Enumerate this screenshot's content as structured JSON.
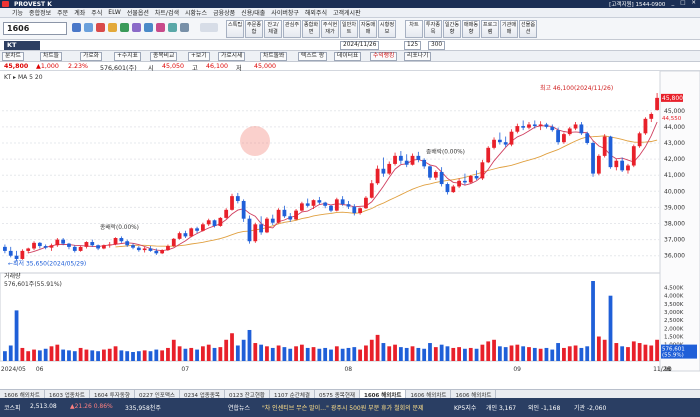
{
  "titlebar": {
    "brand": "PROVEST K",
    "phone": "[고객지원] 1544-0900",
    "controls": [
      "_",
      "□",
      "✕"
    ]
  },
  "menu": [
    "기능",
    "종합정보",
    "주문",
    "계좌",
    "주식",
    "ELW",
    "선물옵션",
    "차트/검색",
    "시황뉴스",
    "금융상품",
    "신용/대출",
    "사이버창구",
    "해외주식",
    "고객게시판"
  ],
  "toolbar": {
    "code": "1606",
    "buttons": [
      "스톡팁",
      "주문종합",
      "잔고/체결",
      "관심주",
      "종합화면",
      "주식현재가",
      "일반차트",
      "자동매매",
      "시황정보",
      "차트",
      "투자종목",
      "일간동향",
      "매매동향",
      "프로그램",
      "기관매매",
      "선물옵션"
    ]
  },
  "stock": {
    "symbol": "KT",
    "period": "일",
    "interval": "1",
    "date": "2024/11/26",
    "count": "125",
    "count2": "300"
  },
  "chart_toolbar": [
    "분차트",
    "차트들",
    "가로화",
    "+수지표",
    "종목비교",
    "+보기",
    "가로시세",
    "차트돌봐",
    "텍스트 랑",
    "데이터표",
    "수익랭킹",
    "리포나기"
  ],
  "quote": {
    "price": "45,800",
    "change": "▲1,000",
    "pct": "2.23%",
    "volume": "576,601(주)",
    "open_lbl": "시",
    "open": "45,050",
    "high_lbl": "고",
    "high": "46,100",
    "low_lbl": "저",
    "low": "45,000"
  },
  "chart_labels": {
    "legend": "KT ▸ MA 5 20",
    "annot_high": "최고 46,100(2024/11/26)",
    "annot_low": "←최저 35,650(2024/05/29)",
    "annot_div1": "종배락(0.00%)",
    "annot_div2": "종배락(0.00%)",
    "volume_title": "거래량",
    "volume_value": "576,601주(55.91%)",
    "right_buttons": [
      "일",
      "매수",
      "매도"
    ],
    "pin": "45,800",
    "sub_pin": "44,550",
    "last_vol": "576,601",
    "last_vol_pct": "(55.9%)"
  },
  "chart_data": {
    "type": "candlestick",
    "y_ticks": [
      36000,
      37000,
      38000,
      39000,
      40000,
      41000,
      42000,
      43000,
      44000,
      45000
    ],
    "y_range": [
      35300,
      46600
    ],
    "x_ticks": [
      "2024/05",
      "06",
      "07",
      "08",
      "09",
      "10",
      "11",
      "11/26"
    ],
    "volume_ticks": [
      "4,500K",
      "4,000K",
      "3,500K",
      "3,000K",
      "2,500K",
      "2,000K",
      "1,500K",
      "1,000K",
      "500K"
    ],
    "volume_max": 4900000,
    "candles": [
      [
        36550,
        36700,
        36150,
        36300
      ],
      [
        36300,
        36550,
        35900,
        36000
      ],
      [
        36000,
        36300,
        35650,
        35800
      ],
      [
        35800,
        36400,
        35750,
        36300
      ],
      [
        36300,
        36500,
        36150,
        36450
      ],
      [
        36450,
        36900,
        36350,
        36800
      ],
      [
        36800,
        36850,
        36450,
        36600
      ],
      [
        36600,
        36700,
        36400,
        36500
      ],
      [
        36500,
        36750,
        36300,
        36650
      ],
      [
        36650,
        37100,
        36550,
        37000
      ],
      [
        37000,
        37100,
        36650,
        36750
      ],
      [
        36750,
        36800,
        36400,
        36550
      ],
      [
        36550,
        36650,
        36200,
        36300
      ],
      [
        36300,
        36600,
        36250,
        36550
      ],
      [
        36550,
        36900,
        36450,
        36850
      ],
      [
        36850,
        37000,
        36550,
        36650
      ],
      [
        36650,
        36700,
        36350,
        36450
      ],
      [
        36450,
        36700,
        36400,
        36650
      ],
      [
        36650,
        36850,
        36500,
        36700
      ],
      [
        36700,
        37150,
        36650,
        37100
      ],
      [
        37100,
        37200,
        36800,
        36900
      ],
      [
        36900,
        37000,
        36550,
        36650
      ],
      [
        36650,
        36750,
        36400,
        36500
      ],
      [
        36500,
        36600,
        36250,
        36350
      ],
      [
        36350,
        36550,
        36200,
        36450
      ],
      [
        36450,
        36600,
        36250,
        36300
      ],
      [
        36300,
        36450,
        36050,
        36150
      ],
      [
        36150,
        36400,
        36100,
        36350
      ],
      [
        36350,
        36700,
        36300,
        36600
      ],
      [
        36600,
        37100,
        36550,
        37050
      ],
      [
        37050,
        37500,
        37000,
        37400
      ],
      [
        37400,
        37550,
        37100,
        37200
      ],
      [
        37200,
        37750,
        37150,
        37700
      ],
      [
        37700,
        37800,
        37400,
        37550
      ],
      [
        37550,
        38050,
        37500,
        37950
      ],
      [
        37950,
        38300,
        37850,
        38200
      ],
      [
        38200,
        38250,
        37750,
        37850
      ],
      [
        37850,
        38400,
        37800,
        38350
      ],
      [
        38350,
        38950,
        38300,
        38850
      ],
      [
        38850,
        39850,
        38800,
        39700
      ],
      [
        39700,
        39900,
        39250,
        39400
      ],
      [
        39400,
        39500,
        38100,
        38300
      ],
      [
        38300,
        38500,
        36750,
        36900
      ],
      [
        36900,
        38050,
        36800,
        37950
      ],
      [
        37950,
        38450,
        37300,
        37450
      ],
      [
        37450,
        38400,
        37400,
        38300
      ],
      [
        38300,
        38550,
        37900,
        38050
      ],
      [
        38050,
        38950,
        38000,
        38850
      ],
      [
        38850,
        39100,
        38350,
        38450
      ],
      [
        38450,
        38650,
        38100,
        38250
      ],
      [
        38250,
        38900,
        38200,
        38800
      ],
      [
        38800,
        39350,
        38750,
        39250
      ],
      [
        39250,
        39550,
        39000,
        39100
      ],
      [
        39100,
        39500,
        38900,
        39450
      ],
      [
        39450,
        39650,
        39200,
        39300
      ],
      [
        39300,
        39350,
        38950,
        39100
      ],
      [
        39100,
        39150,
        38700,
        38800
      ],
      [
        38800,
        39600,
        38750,
        39500
      ],
      [
        39500,
        39700,
        39100,
        39200
      ],
      [
        39200,
        39400,
        38900,
        39050
      ],
      [
        39050,
        39200,
        38500,
        38650
      ],
      [
        38650,
        39000,
        38550,
        38950
      ],
      [
        38950,
        39700,
        38900,
        39600
      ],
      [
        39600,
        40700,
        39550,
        40500
      ],
      [
        40500,
        41600,
        40400,
        41400
      ],
      [
        41400,
        42100,
        40900,
        41100
      ],
      [
        41100,
        41850,
        41000,
        41700
      ],
      [
        41700,
        42400,
        41600,
        42200
      ],
      [
        42200,
        42500,
        41700,
        41900
      ],
      [
        41900,
        42300,
        41500,
        41650
      ],
      [
        41650,
        42350,
        41600,
        42200
      ],
      [
        42200,
        42450,
        41800,
        41950
      ],
      [
        41950,
        42050,
        41400,
        41550
      ],
      [
        41550,
        41600,
        40700,
        40850
      ],
      [
        40850,
        41300,
        40700,
        41200
      ],
      [
        41200,
        41500,
        40300,
        40450
      ],
      [
        40450,
        40550,
        39800,
        39950
      ],
      [
        39950,
        40400,
        39900,
        40300
      ],
      [
        40300,
        40800,
        40200,
        40650
      ],
      [
        40650,
        41100,
        40400,
        40550
      ],
      [
        40550,
        41000,
        40500,
        40950
      ],
      [
        40950,
        41300,
        40700,
        40800
      ],
      [
        40800,
        41950,
        40700,
        41800
      ],
      [
        41800,
        42800,
        41750,
        42700
      ],
      [
        42700,
        43350,
        42600,
        43200
      ],
      [
        43200,
        43650,
        42900,
        43050
      ],
      [
        43050,
        43400,
        42750,
        42900
      ],
      [
        42900,
        43850,
        42800,
        43700
      ],
      [
        43700,
        44200,
        43600,
        44050
      ],
      [
        44050,
        44400,
        43800,
        43950
      ],
      [
        43950,
        44300,
        43850,
        44150
      ],
      [
        44150,
        44400,
        43900,
        44050
      ],
      [
        44050,
        44350,
        43800,
        44150
      ],
      [
        44150,
        44250,
        43900,
        44000
      ],
      [
        44000,
        44150,
        43700,
        43800
      ],
      [
        43800,
        43950,
        42900,
        43050
      ],
      [
        43050,
        43650,
        42950,
        43550
      ],
      [
        43550,
        44000,
        43450,
        43900
      ],
      [
        43900,
        44300,
        43800,
        44150
      ],
      [
        44150,
        44300,
        43500,
        43600
      ],
      [
        43600,
        43700,
        42900,
        43000
      ],
      [
        43000,
        43100,
        40900,
        41100
      ],
      [
        41100,
        42300,
        41000,
        42200
      ],
      [
        42200,
        43550,
        42100,
        43400
      ],
      [
        43400,
        43450,
        41400,
        41500
      ],
      [
        41500,
        42000,
        41300,
        41900
      ],
      [
        41900,
        42100,
        41200,
        41300
      ],
      [
        41300,
        41700,
        41100,
        41600
      ],
      [
        41600,
        42900,
        41500,
        42800
      ],
      [
        42800,
        43700,
        42700,
        43600
      ],
      [
        43600,
        44600,
        43500,
        44500
      ],
      [
        44500,
        44900,
        44300,
        44800
      ],
      [
        45050,
        46100,
        45000,
        45800
      ]
    ],
    "volume": [
      600,
      950,
      3100,
      800,
      600,
      700,
      650,
      750,
      900,
      1000,
      700,
      650,
      600,
      800,
      700,
      650,
      600,
      700,
      750,
      900,
      650,
      600,
      550,
      600,
      650,
      600,
      700,
      650,
      800,
      1300,
      900,
      750,
      800,
      700,
      900,
      1000,
      800,
      850,
      1300,
      1700,
      950,
      1300,
      1900,
      1100,
      1000,
      900,
      800,
      950,
      850,
      750,
      900,
      1000,
      800,
      850,
      750,
      800,
      700,
      900,
      750,
      800,
      850,
      700,
      950,
      1300,
      1600,
      1100,
      900,
      1000,
      850,
      800,
      900,
      800,
      750,
      1100,
      850,
      1000,
      900,
      800,
      850,
      750,
      800,
      750,
      1000,
      1200,
      1300,
      900,
      850,
      950,
      1000,
      900,
      850,
      800,
      750,
      800,
      700,
      1100,
      800,
      900,
      950,
      800,
      900,
      4900,
      1500,
      1300,
      4000,
      1100,
      900,
      850,
      1200,
      1100,
      1000,
      950,
      1300
    ]
  },
  "tabs": [
    "1606 해외차트",
    "1603 업종차트",
    "1604 투자동향",
    "0227 인포맥스",
    "0234 업종종목",
    "0123 잔고현황",
    "1107 순간체결",
    "0575 종목현재",
    "1606 해외차트",
    "1606 해외차트",
    "1606 해외차트"
  ],
  "status": {
    "kospi_lbl": "코스피",
    "kospi": "2,513.08",
    "kospi_chg": "▲21.26  0.86%",
    "kospi_vol": "335,958천주",
    "news_lbl": "연합뉴스",
    "news": "\"차 인센티브 무슨 말이…\" 광주시 500원 부분 휴가 철회의 문제",
    "kp_lbl": "KP5지수",
    "kp_a": "개인 3,167",
    "kp_b": "외인 -1,168",
    "kp_c": "기관 -2,060"
  }
}
